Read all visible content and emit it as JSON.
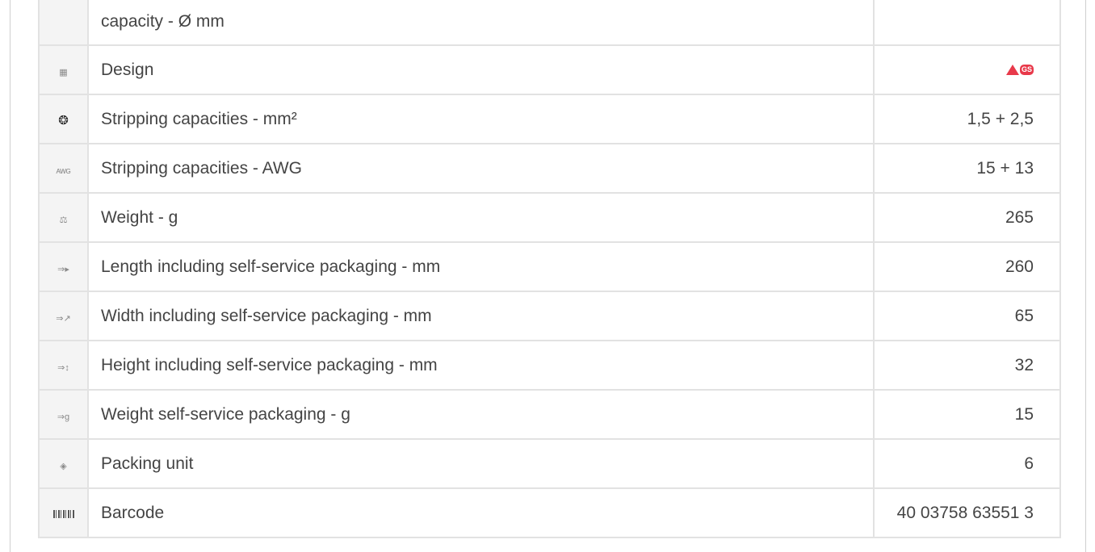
{
  "rows": [
    {
      "icon": "",
      "label": "capacity - Ø mm",
      "value": ""
    },
    {
      "icon": "design-icon",
      "label": "Design",
      "value": ""
    },
    {
      "icon": "stripping-capacity-mm2-icon",
      "label": "Stripping capacities - mm²",
      "value": "1,5 + 2,5"
    },
    {
      "icon": "awg-icon",
      "label": "Stripping capacities - AWG",
      "value": "15 + 13"
    },
    {
      "icon": "scale-icon",
      "label": "Weight - g",
      "value": "265"
    },
    {
      "icon": "package-length-icon",
      "label": "Length including self-service packaging - mm",
      "value": "260"
    },
    {
      "icon": "package-width-icon",
      "label": "Width including self-service packaging - mm",
      "value": "65"
    },
    {
      "icon": "package-height-icon",
      "label": "Height including self-service packaging - mm",
      "value": "32"
    },
    {
      "icon": "package-weight-icon",
      "label": "Weight self-service packaging - g",
      "value": "15"
    },
    {
      "icon": "packing-unit-icon",
      "label": "Packing unit",
      "value": "6"
    },
    {
      "icon": "barcode-icon",
      "label": "Barcode",
      "value": "40 03758 63551 3"
    }
  ],
  "icon_glyphs": {
    "awg": "AWG",
    "package_weight_suffix": "g"
  },
  "colors": {
    "border": "#e2e2e2",
    "icon_cell_bg": "#f4f4f4",
    "text": "#444444",
    "gs_red": "#e8394a"
  }
}
